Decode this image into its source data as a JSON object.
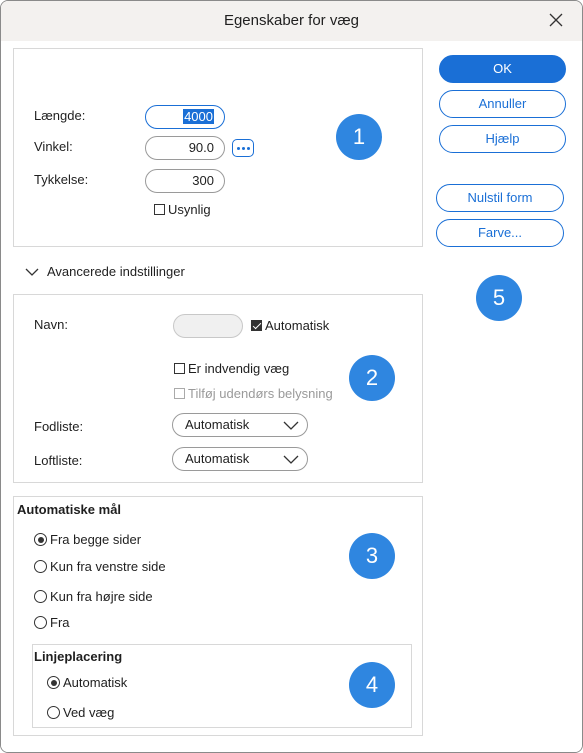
{
  "window": {
    "title": "Egenskaber for væg"
  },
  "basic": {
    "length_label": "Længde:",
    "length_value": "4000",
    "angle_label": "Vinkel:",
    "angle_value": "90.0",
    "thickness_label": "Tykkelse:",
    "thickness_value": "300",
    "invisible_label": "Usynlig",
    "invisible_checked": false
  },
  "advanced": {
    "expander_label": "Avancerede indstillinger",
    "name_label": "Navn:",
    "name_value": "",
    "auto_label": "Automatisk",
    "auto_checked": true,
    "interior_label": "Er indvendig væg",
    "interior_checked": false,
    "exterior_lighting_label": "Tilføj udendørs belysning",
    "exterior_lighting_checked": false,
    "floor_label": "Fodliste:",
    "floor_value": "Automatisk",
    "ceiling_label": "Loftliste:",
    "ceiling_value": "Automatisk"
  },
  "dimensions": {
    "title": "Automatiske mål",
    "options": [
      {
        "label": "Fra begge sider",
        "checked": true
      },
      {
        "label": "Kun fra venstre side",
        "checked": false
      },
      {
        "label": "Kun fra højre side",
        "checked": false
      },
      {
        "label": "Fra",
        "checked": false
      }
    ],
    "line_placement": {
      "title": "Linjeplacering",
      "options": [
        {
          "label": "Automatisk",
          "checked": true
        },
        {
          "label": "Ved væg",
          "checked": false
        }
      ]
    }
  },
  "buttons": {
    "ok": "OK",
    "cancel": "Annuller",
    "help": "Hjælp",
    "reset_shape": "Nulstil form",
    "color": "Farve..."
  },
  "badges": [
    "1",
    "2",
    "3",
    "4",
    "5"
  ],
  "colors": {
    "accent": "#1a6fd6",
    "badge": "#2f86e0",
    "titlebar": "#f3f1ef"
  },
  "icons": {
    "close": "close-icon",
    "more": "more-dots-icon",
    "expander": "chevron-down-icon",
    "dropdown": "chevron-down-icon"
  }
}
